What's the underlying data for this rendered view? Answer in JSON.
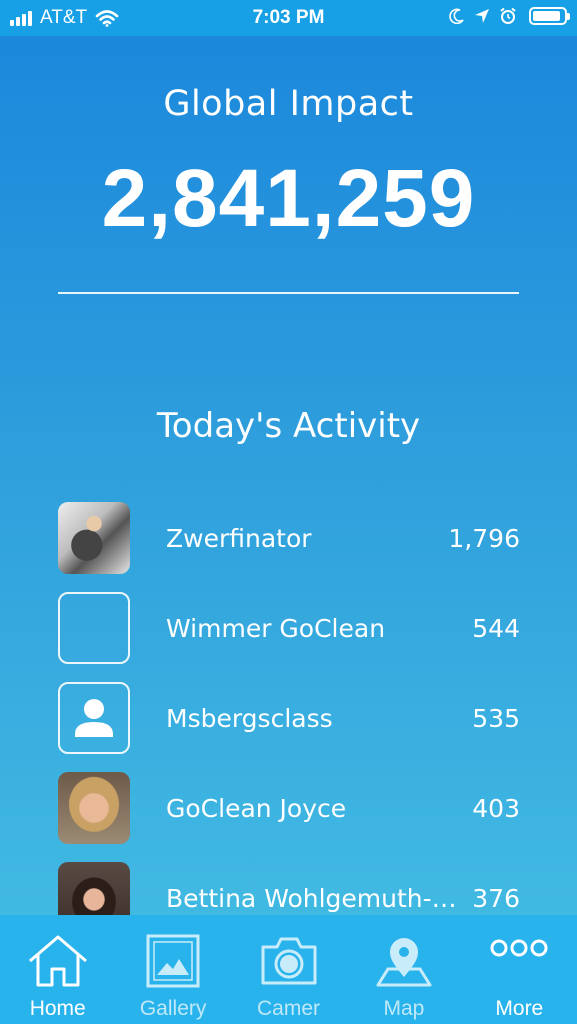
{
  "status_bar": {
    "carrier": "AT&T",
    "time": "7:03 PM",
    "battery_level": 0.9
  },
  "global_impact": {
    "title": "Global Impact",
    "value": "2,841,259"
  },
  "activity": {
    "title": "Today's Activity",
    "items": [
      {
        "name": "Zwerfinator",
        "count": "1,796",
        "avatar": "photo"
      },
      {
        "name": "Wimmer GoClean",
        "count": "544",
        "avatar": "empty"
      },
      {
        "name": "Msbergsclass",
        "count": "535",
        "avatar": "person-icon"
      },
      {
        "name": "GoClean Joyce",
        "count": "403",
        "avatar": "photo"
      },
      {
        "name": "Bettina Wohlgemuth-…",
        "count": "376",
        "avatar": "photo"
      }
    ]
  },
  "tab_bar": {
    "tabs": [
      {
        "label": "Home",
        "icon": "home-icon",
        "active": true
      },
      {
        "label": "Gallery",
        "icon": "gallery-icon",
        "active": false
      },
      {
        "label": "Camer",
        "icon": "camera-icon",
        "active": false
      },
      {
        "label": "Map",
        "icon": "map-pin-icon",
        "active": false
      },
      {
        "label": "More",
        "icon": "more-icon",
        "active": false
      }
    ]
  },
  "colors": {
    "background_top": "#1a86dc",
    "background_bottom": "#45c0e4",
    "status_bar": "#17a0e6",
    "tab_bar": "#29b3ec",
    "text": "#ffffff"
  }
}
